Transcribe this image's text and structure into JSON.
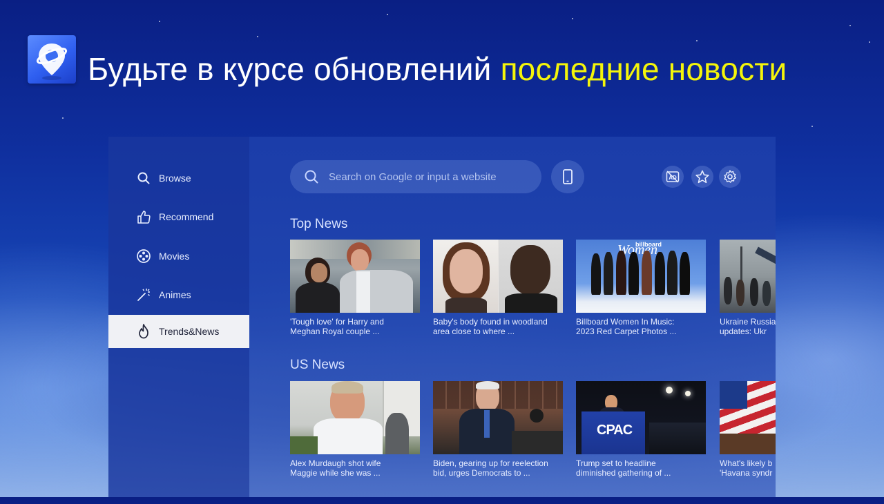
{
  "headline": {
    "text_white": "Будьте в курсе обновлений",
    "text_accent": "последние новости",
    "accent_color": "#f4f50a"
  },
  "app": {
    "logo_icon": "planet-pin-icon"
  },
  "sidebar": {
    "items": [
      {
        "label": "Browse",
        "icon": "search-icon",
        "active": false
      },
      {
        "label": "Recommend",
        "icon": "thumbs-up-icon",
        "active": false
      },
      {
        "label": "Movies",
        "icon": "film-reel-icon",
        "active": false
      },
      {
        "label": "Animes",
        "icon": "magic-wand-icon",
        "active": false
      },
      {
        "label": "Trends&News",
        "icon": "flame-icon",
        "active": true
      }
    ]
  },
  "toolbar": {
    "search_placeholder": "Search on Google or input a website",
    "icons": [
      "phone-icon",
      "ad-block-icon",
      "star-icon",
      "gear-icon"
    ]
  },
  "sections": [
    {
      "title": "Top News",
      "cards": [
        {
          "line1": "'Tough love' for Harry and",
          "line2": "Meghan Royal couple ..."
        },
        {
          "line1": "Baby's body found in woodland",
          "line2": "area close to where ..."
        },
        {
          "line1": "Billboard Women In Music:",
          "line2": "2023 Red Carpet Photos ..."
        },
        {
          "line1": "Ukraine Russia",
          "line2": "updates:  Ukr"
        }
      ]
    },
    {
      "title": "US News",
      "cards": [
        {
          "line1": "Alex Murdaugh shot wife",
          "line2": "Maggie while she was ..."
        },
        {
          "line1": "Biden, gearing up for reelection",
          "line2": "bid, urges Democrats to ..."
        },
        {
          "line1": "Trump set to headline",
          "line2": "diminished gathering of ..."
        },
        {
          "line1": "What's likely b",
          "line2": "'Havana syndr"
        }
      ]
    }
  ],
  "thumb_labels": {
    "billboard": "billboard",
    "women": "Women",
    "cpac": "CPAC"
  }
}
